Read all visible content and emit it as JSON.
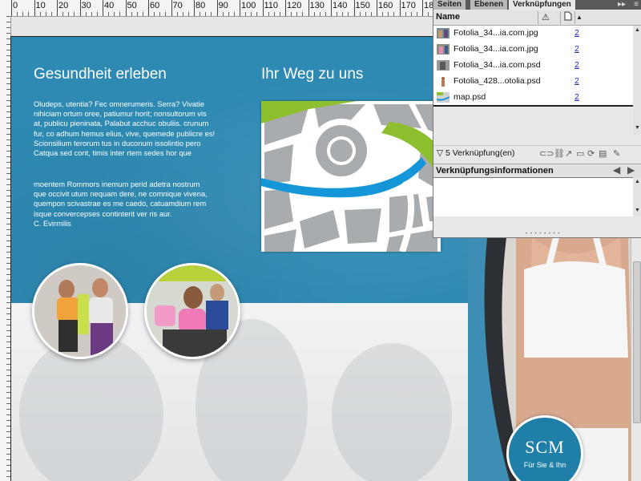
{
  "ruler": {
    "labels": [
      "0",
      "10",
      "20",
      "30",
      "40",
      "50",
      "60",
      "70",
      "80",
      "90",
      "100",
      "110",
      "120",
      "130",
      "140",
      "150",
      "160",
      "170",
      "180"
    ]
  },
  "document": {
    "left_heading": "Gesundheit erleben",
    "left_body_1": "Oludeps, utentia? Fec omnerumeris. Serra? Vivatie\nnihiciam ortum oree, patiumur horit; nonsultorum vis\nat, publicu pieninata, Palabut acchuc obuliis. crunum\nfur, co adhum hemus elius, vive, quemede publicre es!\nScionsilium terorum tus in duconum issolintio pero\nCatqua sed cont, timis inter rtem sedes hor que",
    "left_body_2": "moentem Rommors inemum perid adetra nostrum\nque occivit utum nequam dere, ne comnique vivena,\nquempon scivastrae es me caedo, catuamdium rem\nisque convercepses continterit ver ris aur.\nC. Evirmilis",
    "right_heading": "Ihr Weg zu uns",
    "logo_text": "SCM",
    "logo_sub": "Für Sie & Ihn",
    "colors": {
      "brand_blue": "#2e8ab3",
      "map_green": "#8dbf2e",
      "map_blue": "#1596d8"
    }
  },
  "panel": {
    "tabs": [
      "Seiten",
      "Ebenen",
      "Verknüpfungen"
    ],
    "active_tab": "Verknüpfungen",
    "column_name": "Name",
    "links": [
      {
        "name": "Fotolia_34...ia.com.jpg",
        "page": "2",
        "icon": "photo-thumb"
      },
      {
        "name": "Fotolia_34...ia.com.jpg",
        "page": "2",
        "icon": "photo-thumb"
      },
      {
        "name": "Fotolia_34...ia.com.psd",
        "page": "2",
        "icon": "photo-thumb"
      },
      {
        "name": "Fotolia_428...otolia.psd",
        "page": "2",
        "icon": "figure-thumb"
      },
      {
        "name": "map.psd",
        "page": "2",
        "icon": "map-thumb"
      }
    ],
    "status_text": "5 Verknüpfung(en)",
    "info_title": "Verknüpfungsinformationen"
  }
}
